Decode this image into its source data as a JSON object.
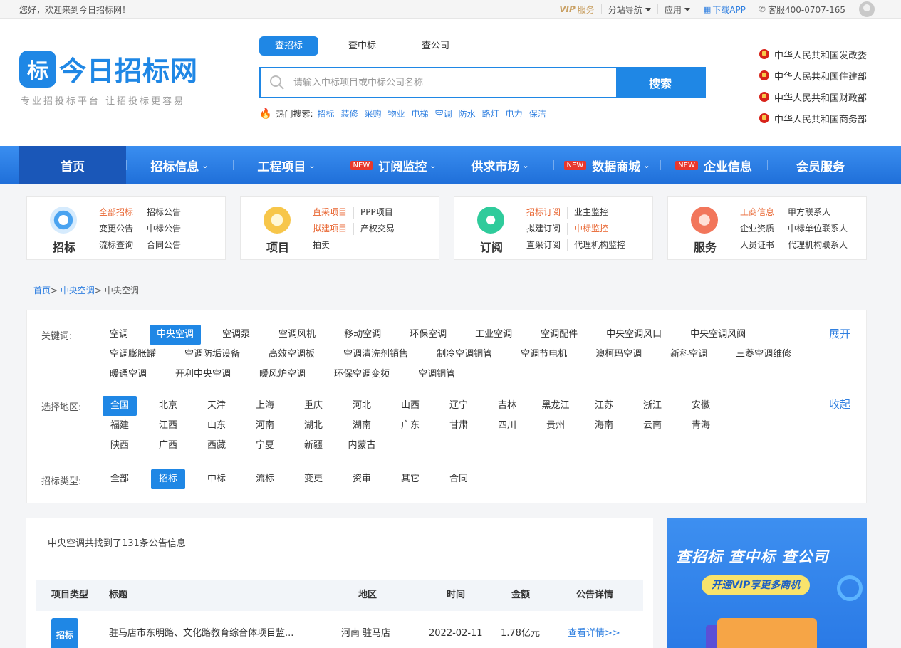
{
  "topbar": {
    "welcome": "您好，欢迎来到今日招标网！",
    "vip_badge": "VIP",
    "vip_text": "服务",
    "sub_nav": "分站导航",
    "apps": "应用",
    "download": "下载APP",
    "service": "客服400-0707-165"
  },
  "header": {
    "logo_char": "标",
    "logo_text": "今日招标网",
    "slogan": "专业招投标平台 让招投标更容易",
    "search_tabs": [
      "查招标",
      "查中标",
      "查公司"
    ],
    "search_placeholder": "请输入中标项目或中标公司名称",
    "search_button": "搜索",
    "hot_label": "热门搜索:",
    "hot_words": [
      "招标",
      "装修",
      "采购",
      "物业",
      "电梯",
      "空调",
      "防水",
      "路灯",
      "电力",
      "保洁"
    ],
    "gov_links": [
      "中华人民共和国发改委",
      "中华人民共和国住建部",
      "中华人民共和国财政部",
      "中华人民共和国商务部"
    ]
  },
  "nav": {
    "new_badge": "NEW",
    "items": [
      {
        "label": "首页",
        "caret": false,
        "new": false
      },
      {
        "label": "招标信息",
        "caret": true,
        "new": false
      },
      {
        "label": "工程项目",
        "caret": true,
        "new": false
      },
      {
        "label": "订阅监控",
        "caret": true,
        "new": true
      },
      {
        "label": "供求市场",
        "caret": true,
        "new": false
      },
      {
        "label": "数据商城",
        "caret": true,
        "new": true
      },
      {
        "label": "企业信息",
        "caret": false,
        "new": true
      },
      {
        "label": "会员服务",
        "caret": false,
        "new": false
      }
    ]
  },
  "cards": [
    {
      "title": "招标",
      "links": [
        "全部招标",
        "招标公告",
        "变更公告",
        "中标公告",
        "流标查询",
        "合同公告"
      ]
    },
    {
      "title": "项目",
      "links": [
        "直采项目",
        "PPP项目",
        "拟建项目",
        "产权交易",
        "拍卖",
        ""
      ]
    },
    {
      "title": "订阅",
      "links": [
        "招标订阅",
        "业主监控",
        "拟建订阅",
        "中标监控",
        "直采订阅",
        "代理机构监控"
      ]
    },
    {
      "title": "服务",
      "links": [
        "工商信息",
        "甲方联系人",
        "企业资质",
        "中标单位联系人",
        "人员证书",
        "代理机构联系人"
      ]
    }
  ],
  "breadcrumb": {
    "home": "首页",
    "sep": ">",
    "level1": "中央空调",
    "current": "中央空调"
  },
  "filter": {
    "keyword_label": "关键词:",
    "keywords": [
      "空调",
      "中央空调",
      "空调泵",
      "空调风机",
      "移动空调",
      "环保空调",
      "工业空调",
      "空调配件",
      "中央空调风口",
      "中央空调风阀",
      "空调膨胀罐",
      "空调防垢设备",
      "高效空调板",
      "空调清洗剂销售",
      "制冷空调铜管",
      "空调节电机",
      "澳柯玛空调",
      "新科空调",
      "三菱空调维修",
      "暖通空调",
      "开利中央空调",
      "暖风炉空调",
      "环保空调变频",
      "空调铜管"
    ],
    "keyword_selected": "中央空调",
    "expand": "展开",
    "region_label": "选择地区:",
    "regions": [
      "全国",
      "北京",
      "天津",
      "上海",
      "重庆",
      "河北",
      "山西",
      "辽宁",
      "吉林",
      "黑龙江",
      "江苏",
      "浙江",
      "安徽",
      "福建",
      "江西",
      "山东",
      "河南",
      "湖北",
      "湖南",
      "广东",
      "甘肃",
      "四川",
      "贵州",
      "海南",
      "云南",
      "青海",
      "陕西",
      "广西",
      "西藏",
      "宁夏",
      "新疆",
      "内蒙古"
    ],
    "region_selected": "全国",
    "collapse": "收起",
    "type_label": "招标类型:",
    "types": [
      "全部",
      "招标",
      "中标",
      "流标",
      "变更",
      "资审",
      "其它",
      "合同"
    ],
    "type_selected": "招标"
  },
  "results": {
    "count_text": "中央空调共找到了131条公告信息",
    "headers": [
      "项目类型",
      "标题",
      "地区",
      "时间",
      "金额",
      "公告详情"
    ],
    "rows": [
      {
        "type": "招标",
        "title": "驻马店市东明路、文化路教育综合体项目监...",
        "region": "河南 驻马店",
        "date": "2022-02-11",
        "amount": "1.78亿元",
        "detail": "查看详情>>"
      }
    ]
  },
  "banner": {
    "headline": "查招标 查中标 查公司",
    "sub": "开通VIP享更多商机"
  },
  "colors": {
    "primary": "#1f87e5",
    "nav_active": "#1a57b8",
    "highlight": "#e8622c",
    "new_badge": "#e8382d"
  }
}
